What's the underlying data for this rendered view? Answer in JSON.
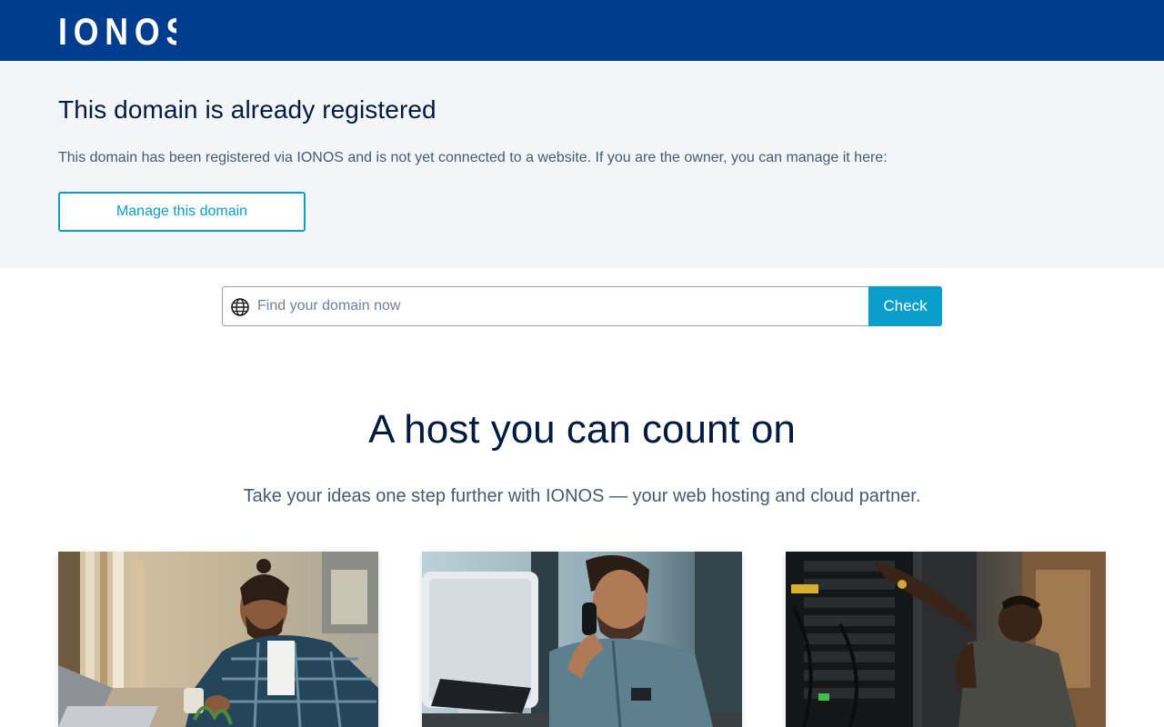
{
  "header": {
    "logo_text": "IONOS",
    "background": "#003d8f"
  },
  "notice": {
    "title": "This domain is already registered",
    "text": "This domain has been registered via IONOS and is not yet connected to a website. If you are the owner, you can manage it here:",
    "manage_button": "Manage this domain"
  },
  "search": {
    "icon": "globe-icon",
    "placeholder": "Find your domain now",
    "value": "",
    "button": "Check"
  },
  "hero": {
    "title": "A host you can count on",
    "subtitle": "Take your ideas one step further with IONOS — your web hosting and cloud partner."
  },
  "cards": [
    {
      "image": "man-working-at-laptop-in-workshop"
    },
    {
      "image": "man-on-phone-at-computer-desk"
    },
    {
      "image": "technician-at-server-rack"
    }
  ],
  "colors": {
    "brand": "#003d8f",
    "accent": "#0b9dcc",
    "heading": "#001b41",
    "body_text": "#465a75",
    "notice_bg": "#f4f5f7"
  }
}
